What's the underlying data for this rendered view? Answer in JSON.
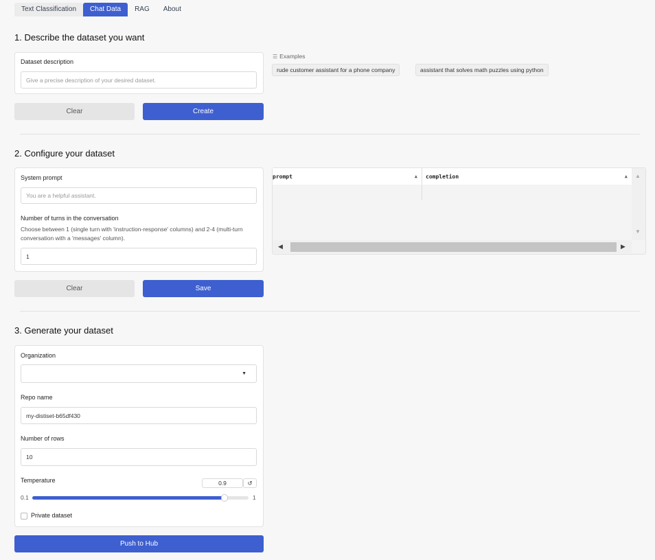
{
  "tabs": [
    {
      "label": "Text Classification"
    },
    {
      "label": "Chat Data"
    },
    {
      "label": "RAG"
    },
    {
      "label": "About"
    }
  ],
  "section1": {
    "title": "1. Describe the dataset you want",
    "description_label": "Dataset description",
    "description_placeholder": "Give a precise description of your desired dataset.",
    "examples_label": "Examples",
    "examples": [
      "rude customer assistant for a phone company",
      "assistant that solves math puzzles using python"
    ],
    "clear_label": "Clear",
    "create_label": "Create"
  },
  "section2": {
    "title": "2. Configure your dataset",
    "system_prompt_label": "System prompt",
    "system_prompt_placeholder": "You are a helpful assistant.",
    "turns_label": "Number of turns in the conversation",
    "turns_hint": "Choose between 1 (single turn with 'instruction-response' columns) and 2-4 (multi-turn conversation with a 'messages' column).",
    "turns_value": "1",
    "clear_label": "Clear",
    "save_label": "Save",
    "table_columns": [
      "prompt",
      "completion"
    ]
  },
  "section3": {
    "title": "3. Generate your dataset",
    "org_label": "Organization",
    "org_value": "",
    "repo_label": "Repo name",
    "repo_value": "my-distiset-b65df430",
    "rows_label": "Number of rows",
    "rows_value": "10",
    "temp_label": "Temperature",
    "temp_value": "0.9",
    "temp_min": "0.1",
    "temp_max": "1",
    "temp_fraction": 0.889,
    "private_label": "Private dataset",
    "private_checked": false,
    "push_label": "Push to Hub"
  },
  "colors": {
    "accent": "#3e5fcf",
    "button_gray": "#e5e5e5",
    "background": "#f7f7f7"
  }
}
